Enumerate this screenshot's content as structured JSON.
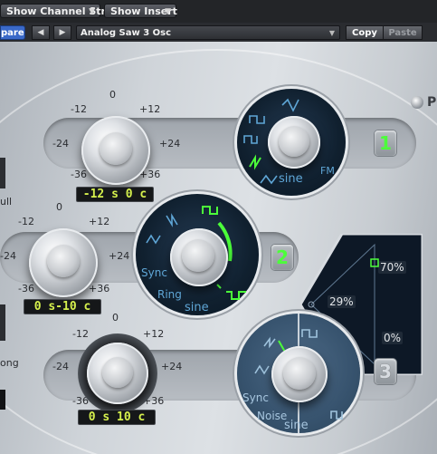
{
  "toolbar": {
    "show_channel_strip": "Show Channel Strip",
    "show_insert": "Show Insert",
    "compare": "pare",
    "nav_prev": "◀",
    "nav_next": "▶",
    "preset_name": "Analog Saw 3 Osc",
    "copy": "Copy",
    "paste": "Paste"
  },
  "header": {
    "power_letter": "P"
  },
  "tune_scale": {
    "top": "0",
    "minus12": "-12",
    "plus12": "+12",
    "minus24": "-24",
    "plus24": "+24",
    "minus36": "-36",
    "plus36": "+36"
  },
  "side_labels": {
    "pull": "ull",
    "long": "ong"
  },
  "oscillators": [
    {
      "number": "1",
      "readout": "-12 s   0 c",
      "wave_label": "sine",
      "mod_label": "FM",
      "active": true,
      "number_color": "#4cff3a"
    },
    {
      "number": "2",
      "readout": "0 s-10 c",
      "wave_label": "sine",
      "mod_label_1": "Sync",
      "mod_label_2": "Ring",
      "active": true,
      "number_color": "#4cff3a"
    },
    {
      "number": "3",
      "readout": "0 s 10 c",
      "wave_label": "sine",
      "mod_label_1": "Sync",
      "mod_label_2": "Noise",
      "active": false,
      "number_color": "#d7dbe0"
    }
  ],
  "mixer": {
    "osc1_pct": "70%",
    "osc2_pct": "29%",
    "osc3_pct": "0%"
  },
  "colors": {
    "accent_green": "#4cff3a",
    "readout_text": "#d5f04d",
    "osc_label_blue": "#5fa6d6",
    "compare_blue": "#3a69c8"
  },
  "icons": [
    "chevron-down-icon",
    "arrow-left-icon",
    "arrow-right-icon",
    "power-led-icon",
    "square-wave-icon",
    "sawtooth-wave-icon",
    "pulse-wave-icon",
    "triangle-wave-icon",
    "noise-wave-icon"
  ]
}
